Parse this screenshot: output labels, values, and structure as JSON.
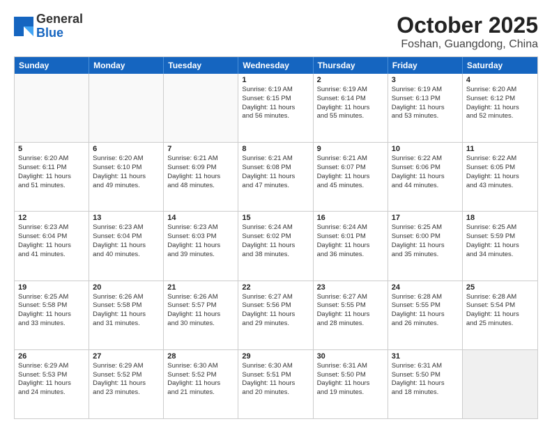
{
  "header": {
    "logo_general": "General",
    "logo_blue": "Blue",
    "month": "October 2025",
    "location": "Foshan, Guangdong, China"
  },
  "weekdays": [
    "Sunday",
    "Monday",
    "Tuesday",
    "Wednesday",
    "Thursday",
    "Friday",
    "Saturday"
  ],
  "rows": [
    [
      {
        "day": "",
        "lines": [],
        "empty": true
      },
      {
        "day": "",
        "lines": [],
        "empty": true
      },
      {
        "day": "",
        "lines": [],
        "empty": true
      },
      {
        "day": "1",
        "lines": [
          "Sunrise: 6:19 AM",
          "Sunset: 6:15 PM",
          "Daylight: 11 hours",
          "and 56 minutes."
        ]
      },
      {
        "day": "2",
        "lines": [
          "Sunrise: 6:19 AM",
          "Sunset: 6:14 PM",
          "Daylight: 11 hours",
          "and 55 minutes."
        ]
      },
      {
        "day": "3",
        "lines": [
          "Sunrise: 6:19 AM",
          "Sunset: 6:13 PM",
          "Daylight: 11 hours",
          "and 53 minutes."
        ]
      },
      {
        "day": "4",
        "lines": [
          "Sunrise: 6:20 AM",
          "Sunset: 6:12 PM",
          "Daylight: 11 hours",
          "and 52 minutes."
        ]
      }
    ],
    [
      {
        "day": "5",
        "lines": [
          "Sunrise: 6:20 AM",
          "Sunset: 6:11 PM",
          "Daylight: 11 hours",
          "and 51 minutes."
        ]
      },
      {
        "day": "6",
        "lines": [
          "Sunrise: 6:20 AM",
          "Sunset: 6:10 PM",
          "Daylight: 11 hours",
          "and 49 minutes."
        ]
      },
      {
        "day": "7",
        "lines": [
          "Sunrise: 6:21 AM",
          "Sunset: 6:09 PM",
          "Daylight: 11 hours",
          "and 48 minutes."
        ]
      },
      {
        "day": "8",
        "lines": [
          "Sunrise: 6:21 AM",
          "Sunset: 6:08 PM",
          "Daylight: 11 hours",
          "and 47 minutes."
        ]
      },
      {
        "day": "9",
        "lines": [
          "Sunrise: 6:21 AM",
          "Sunset: 6:07 PM",
          "Daylight: 11 hours",
          "and 45 minutes."
        ]
      },
      {
        "day": "10",
        "lines": [
          "Sunrise: 6:22 AM",
          "Sunset: 6:06 PM",
          "Daylight: 11 hours",
          "and 44 minutes."
        ]
      },
      {
        "day": "11",
        "lines": [
          "Sunrise: 6:22 AM",
          "Sunset: 6:05 PM",
          "Daylight: 11 hours",
          "and 43 minutes."
        ]
      }
    ],
    [
      {
        "day": "12",
        "lines": [
          "Sunrise: 6:23 AM",
          "Sunset: 6:04 PM",
          "Daylight: 11 hours",
          "and 41 minutes."
        ]
      },
      {
        "day": "13",
        "lines": [
          "Sunrise: 6:23 AM",
          "Sunset: 6:04 PM",
          "Daylight: 11 hours",
          "and 40 minutes."
        ]
      },
      {
        "day": "14",
        "lines": [
          "Sunrise: 6:23 AM",
          "Sunset: 6:03 PM",
          "Daylight: 11 hours",
          "and 39 minutes."
        ]
      },
      {
        "day": "15",
        "lines": [
          "Sunrise: 6:24 AM",
          "Sunset: 6:02 PM",
          "Daylight: 11 hours",
          "and 38 minutes."
        ]
      },
      {
        "day": "16",
        "lines": [
          "Sunrise: 6:24 AM",
          "Sunset: 6:01 PM",
          "Daylight: 11 hours",
          "and 36 minutes."
        ]
      },
      {
        "day": "17",
        "lines": [
          "Sunrise: 6:25 AM",
          "Sunset: 6:00 PM",
          "Daylight: 11 hours",
          "and 35 minutes."
        ]
      },
      {
        "day": "18",
        "lines": [
          "Sunrise: 6:25 AM",
          "Sunset: 5:59 PM",
          "Daylight: 11 hours",
          "and 34 minutes."
        ]
      }
    ],
    [
      {
        "day": "19",
        "lines": [
          "Sunrise: 6:25 AM",
          "Sunset: 5:58 PM",
          "Daylight: 11 hours",
          "and 33 minutes."
        ]
      },
      {
        "day": "20",
        "lines": [
          "Sunrise: 6:26 AM",
          "Sunset: 5:58 PM",
          "Daylight: 11 hours",
          "and 31 minutes."
        ]
      },
      {
        "day": "21",
        "lines": [
          "Sunrise: 6:26 AM",
          "Sunset: 5:57 PM",
          "Daylight: 11 hours",
          "and 30 minutes."
        ]
      },
      {
        "day": "22",
        "lines": [
          "Sunrise: 6:27 AM",
          "Sunset: 5:56 PM",
          "Daylight: 11 hours",
          "and 29 minutes."
        ]
      },
      {
        "day": "23",
        "lines": [
          "Sunrise: 6:27 AM",
          "Sunset: 5:55 PM",
          "Daylight: 11 hours",
          "and 28 minutes."
        ]
      },
      {
        "day": "24",
        "lines": [
          "Sunrise: 6:28 AM",
          "Sunset: 5:55 PM",
          "Daylight: 11 hours",
          "and 26 minutes."
        ]
      },
      {
        "day": "25",
        "lines": [
          "Sunrise: 6:28 AM",
          "Sunset: 5:54 PM",
          "Daylight: 11 hours",
          "and 25 minutes."
        ]
      }
    ],
    [
      {
        "day": "26",
        "lines": [
          "Sunrise: 6:29 AM",
          "Sunset: 5:53 PM",
          "Daylight: 11 hours",
          "and 24 minutes."
        ]
      },
      {
        "day": "27",
        "lines": [
          "Sunrise: 6:29 AM",
          "Sunset: 5:52 PM",
          "Daylight: 11 hours",
          "and 23 minutes."
        ]
      },
      {
        "day": "28",
        "lines": [
          "Sunrise: 6:30 AM",
          "Sunset: 5:52 PM",
          "Daylight: 11 hours",
          "and 21 minutes."
        ]
      },
      {
        "day": "29",
        "lines": [
          "Sunrise: 6:30 AM",
          "Sunset: 5:51 PM",
          "Daylight: 11 hours",
          "and 20 minutes."
        ]
      },
      {
        "day": "30",
        "lines": [
          "Sunrise: 6:31 AM",
          "Sunset: 5:50 PM",
          "Daylight: 11 hours",
          "and 19 minutes."
        ]
      },
      {
        "day": "31",
        "lines": [
          "Sunrise: 6:31 AM",
          "Sunset: 5:50 PM",
          "Daylight: 11 hours",
          "and 18 minutes."
        ]
      },
      {
        "day": "",
        "lines": [],
        "empty": true,
        "shaded": true
      }
    ]
  ]
}
